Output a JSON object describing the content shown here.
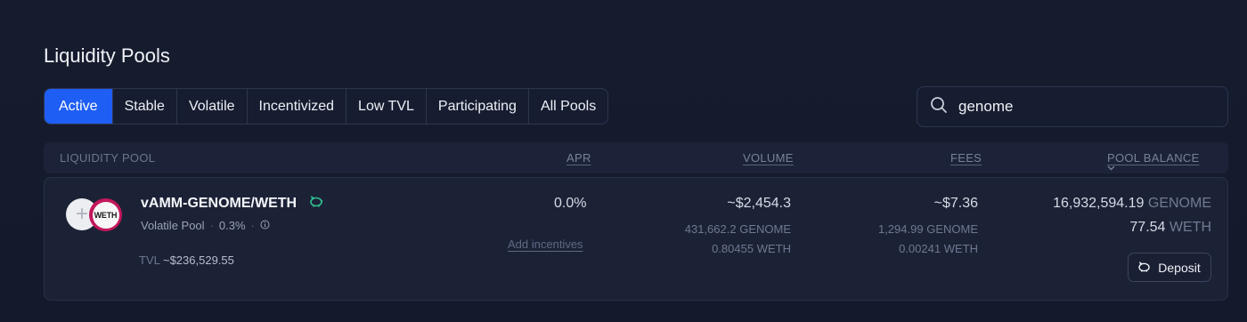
{
  "page": {
    "title": "Liquidity Pools"
  },
  "tabs": [
    "Active",
    "Stable",
    "Volatile",
    "Incentivized",
    "Low TVL",
    "Participating",
    "All Pools"
  ],
  "active_tab": "Active",
  "search": {
    "value": "genome"
  },
  "columns": {
    "pool": "LIQUIDITY POOL",
    "apr": "APR",
    "volume": "VOLUME",
    "fees": "FEES",
    "balance": "POOL BALANCE"
  },
  "pool": {
    "logo1_text": "+",
    "logo2_text": "WETH",
    "name": "vAMM-GENOME/WETH",
    "type": "Volatile Pool",
    "fee_rate": "0.3%",
    "tvl_label": "TVL",
    "tvl_value": "~$236,529.55",
    "apr": "0.0%",
    "add_incentives": "Add incentives",
    "volume": {
      "total": "~$2,454.3",
      "token0_amount": "431,662.2",
      "token0_symbol": "GENOME",
      "token1_amount": "0.80455",
      "token1_symbol": "WETH"
    },
    "fees": {
      "total": "~$7.36",
      "token0_amount": "1,294.99",
      "token0_symbol": "GENOME",
      "token1_amount": "0.00241",
      "token1_symbol": "WETH"
    },
    "balance": {
      "token0_amount": "16,932,594.19",
      "token0_symbol": "GENOME",
      "token1_amount": "77.54",
      "token1_symbol": "WETH"
    },
    "deposit_label": "Deposit"
  },
  "colors": {
    "accent": "#1f5ef5",
    "background": "#151c2e",
    "card": "#1c2236",
    "pool_badge": "#2fbf8f"
  }
}
